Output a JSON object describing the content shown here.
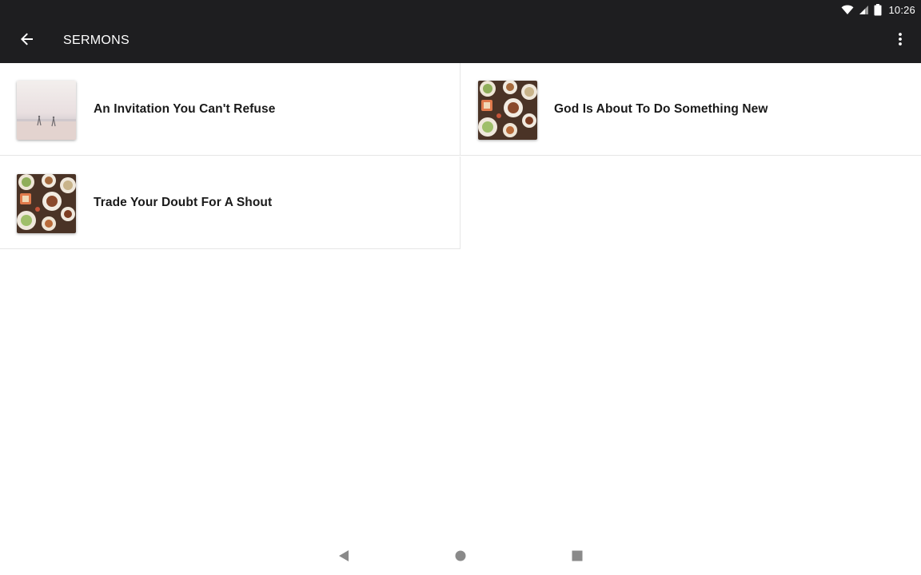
{
  "status_bar": {
    "time": "10:26",
    "icons": [
      "wifi-icon",
      "cell-signal-icon",
      "battery-icon"
    ]
  },
  "app_bar": {
    "title": "SERMONS",
    "back_icon": "arrow-back-icon",
    "menu_icon": "more-vert-icon"
  },
  "sermons": [
    {
      "title": "An Invitation You Can't Refuse",
      "thumbnail": "beach-scene"
    },
    {
      "title": "God Is About To Do Something New",
      "thumbnail": "food-table"
    },
    {
      "title": "Trade Your Doubt For A Shout",
      "thumbnail": "food-table"
    }
  ],
  "nav_bar": {
    "icons": [
      "back-triangle-icon",
      "home-circle-icon",
      "recents-square-icon"
    ]
  },
  "colors": {
    "app_bar": "#1e1e20",
    "background": "#ffffff",
    "divider": "#e6e6e6",
    "nav_icon": "#8a8a8a"
  }
}
